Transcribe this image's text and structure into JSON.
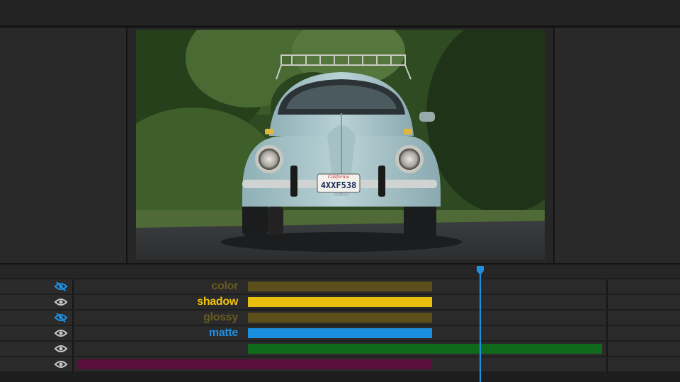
{
  "colors": {
    "color_label": "#6b5a1f",
    "color_bar": "#5c4f1b",
    "shadow_label": "#f2c40d",
    "shadow_bar": "#e8c00b",
    "glossy_label": "#6b5a1f",
    "glossy_bar": "#5c4f1b",
    "matte_label": "#1e90e6",
    "matte_bar": "#1a8fe0",
    "green_bar": "#0f6a1b",
    "purple_bar": "#5a0f3a",
    "playhead": "#1f8fe0"
  },
  "preview": {
    "plate_text": "4XXF538",
    "plate_state": "California"
  },
  "timeline": {
    "layers": [
      {
        "label": "color",
        "icon": "eye-hidden-icon"
      },
      {
        "label": "shadow",
        "icon": "eye-icon"
      },
      {
        "label": "glossy",
        "icon": "eye-hidden-icon"
      },
      {
        "label": "matte",
        "icon": "eye-icon"
      },
      {
        "label": "",
        "icon": "eye-icon"
      },
      {
        "label": "",
        "icon": "eye-icon"
      }
    ]
  }
}
